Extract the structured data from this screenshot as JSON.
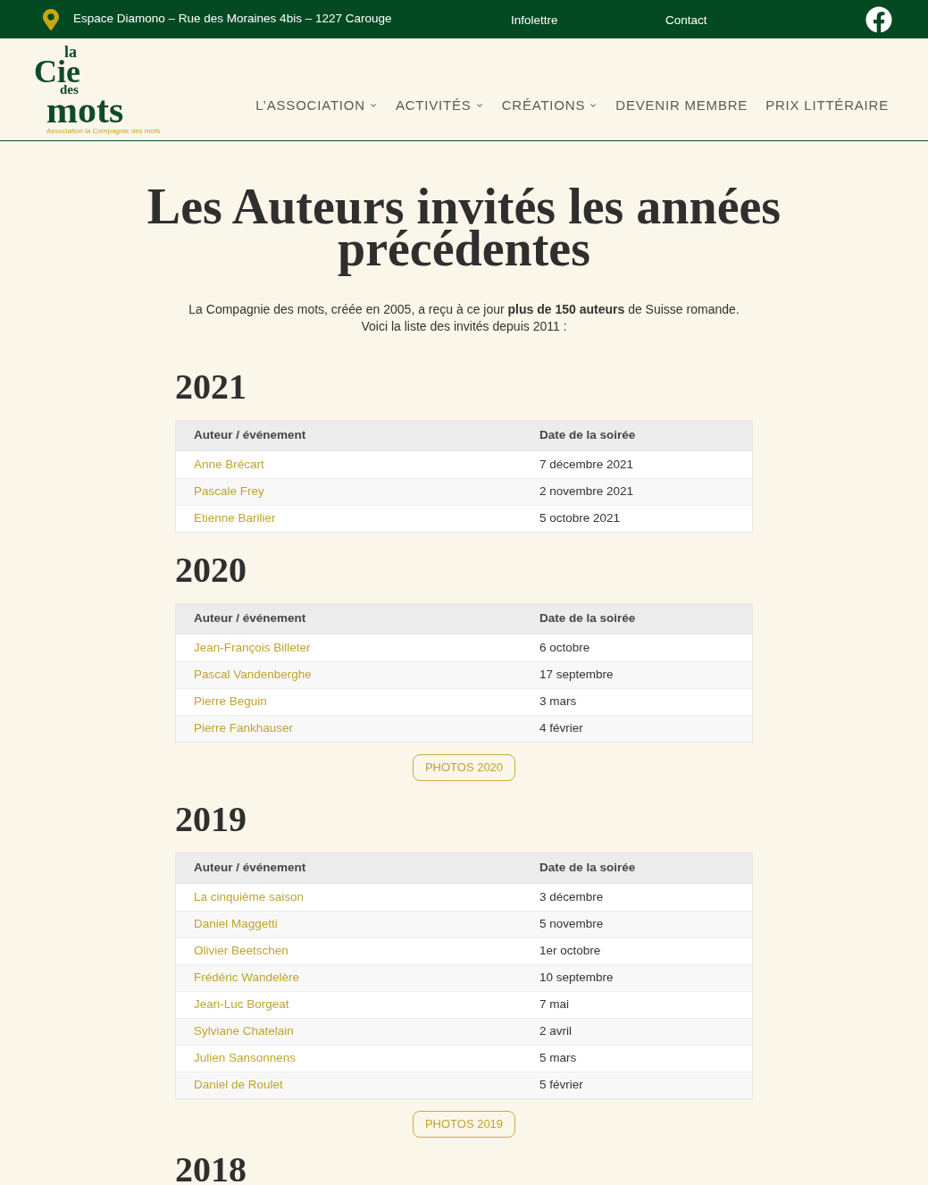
{
  "top_bar": {
    "address": "Espace Diamono – Rue des Moraines 4bis – 1227 Carouge",
    "links": [
      "Infolettre",
      "Contact"
    ]
  },
  "logo": {
    "words": [
      "la",
      "Cie",
      "des",
      "mots"
    ],
    "tagline": "Association la Compagnie des mots"
  },
  "nav": [
    {
      "label": "L’ASSOCIATION",
      "dropdown": true
    },
    {
      "label": "ACTIVITÉS",
      "dropdown": true
    },
    {
      "label": "CRÉATIONS",
      "dropdown": true
    },
    {
      "label": "DEVENIR MEMBRE",
      "dropdown": false
    },
    {
      "label": "PRIX LITTÉRAIRE",
      "dropdown": false
    }
  ],
  "intro": {
    "title": "Les Auteurs invités les années précédentes",
    "lines": [
      "La Compagnie des mots, créée en 2005, a reçu à ce jour **plus de 150 auteurs** de Suisse romande.",
      "Voici la liste des invités depuis 2011 :"
    ]
  },
  "sections": [
    {
      "year": "2021",
      "columns": [
        "Auteur / événement",
        "Date de la soirée"
      ],
      "rows": [
        [
          "Anne Brécart",
          "7 décembre 2021"
        ],
        [
          "Pascale Frey",
          "2 novembre 2021"
        ],
        [
          "Etienne Barilier",
          "5 octobre 2021"
        ]
      ]
    },
    {
      "year": "2020",
      "columns": [
        "Auteur / événement",
        "Date de la soirée"
      ],
      "rows": [
        [
          "Jean-François Billeter",
          "6 octobre"
        ],
        [
          "Pascal Vandenberghe",
          "17 septembre"
        ],
        [
          "Pierre Beguin",
          "3 mars"
        ],
        [
          "Pierre Fankhauser",
          "4 février"
        ]
      ],
      "button": "PHOTOS 2020"
    },
    {
      "year": "2019",
      "columns": [
        "Auteur / événement",
        "Date de la soirée"
      ],
      "rows": [
        [
          "La cinquième saison",
          "3 décembre"
        ],
        [
          "Daniel Maggetti",
          "5 novembre"
        ],
        [
          "Olivier Beetschen",
          "1er octobre"
        ],
        [
          "Frédéric Wandelère",
          "10 septembre"
        ],
        [
          "Jean-Luc Borgeat",
          "7 mai"
        ],
        [
          "Sylviane Chatelain",
          "2 avril"
        ],
        [
          "Julien Sansonnens",
          "5 mars"
        ],
        [
          "Daniel de Roulet",
          "5 février"
        ]
      ],
      "button": "PHOTOS 2019"
    },
    {
      "year": "2018"
    }
  ]
}
